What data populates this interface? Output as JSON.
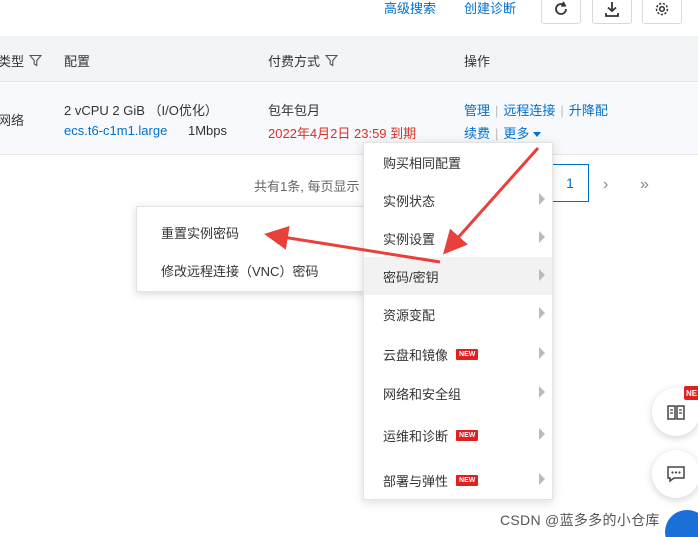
{
  "top_links": {
    "advanced_search": "高级搜索",
    "create_diagnosis": "创建诊断"
  },
  "toolbar_icons": [
    "refresh-icon",
    "download-icon",
    "gear-icon"
  ],
  "table": {
    "headers": {
      "type": "类型",
      "config": "配置",
      "billing": "付费方式",
      "actions": "操作"
    },
    "row": {
      "network": "网络",
      "config_line1": "2 vCPU 2 GiB （I/O优化）",
      "instance_type": "ecs.t6-c1m1.large",
      "bandwidth": "1Mbps",
      "billing_type": "包年包月",
      "expiry": "2022年4月2日 23:59 到期",
      "actions": {
        "manage": "管理",
        "remote": "远程连接",
        "upgrade": "升降配",
        "renew": "续费",
        "more": "更多"
      }
    }
  },
  "pagination": {
    "summary": "共有1条, 每页显示",
    "current_page": "1"
  },
  "submenu": {
    "reset_password": "重置实例密码",
    "modify_vnc_password": "修改远程连接（VNC）密码"
  },
  "menu": {
    "items": [
      {
        "label": "购买相同配置",
        "has_arrow": false,
        "new": false
      },
      {
        "label": "实例状态",
        "has_arrow": true,
        "new": false
      },
      {
        "label": "实例设置",
        "has_arrow": true,
        "new": false
      },
      {
        "label": "密码/密钥",
        "has_arrow": true,
        "new": false,
        "active": true
      },
      {
        "label": "资源变配",
        "has_arrow": true,
        "new": false
      },
      {
        "label": "云盘和镜像",
        "has_arrow": true,
        "new": true
      },
      {
        "label": "网络和安全组",
        "has_arrow": true,
        "new": false
      },
      {
        "label": "运维和诊断",
        "has_arrow": true,
        "new": true
      },
      {
        "label": "部署与弹性",
        "has_arrow": true,
        "new": true
      }
    ],
    "new_badge": "NEW"
  },
  "floating": {
    "badge": "NE"
  },
  "watermark": "CSDN @蓝多多的小仓库",
  "colors": {
    "link": "#0070cc",
    "expiry_red": "#d93026",
    "arrow_red": "#e8403a",
    "new_badge": "#e02020"
  }
}
